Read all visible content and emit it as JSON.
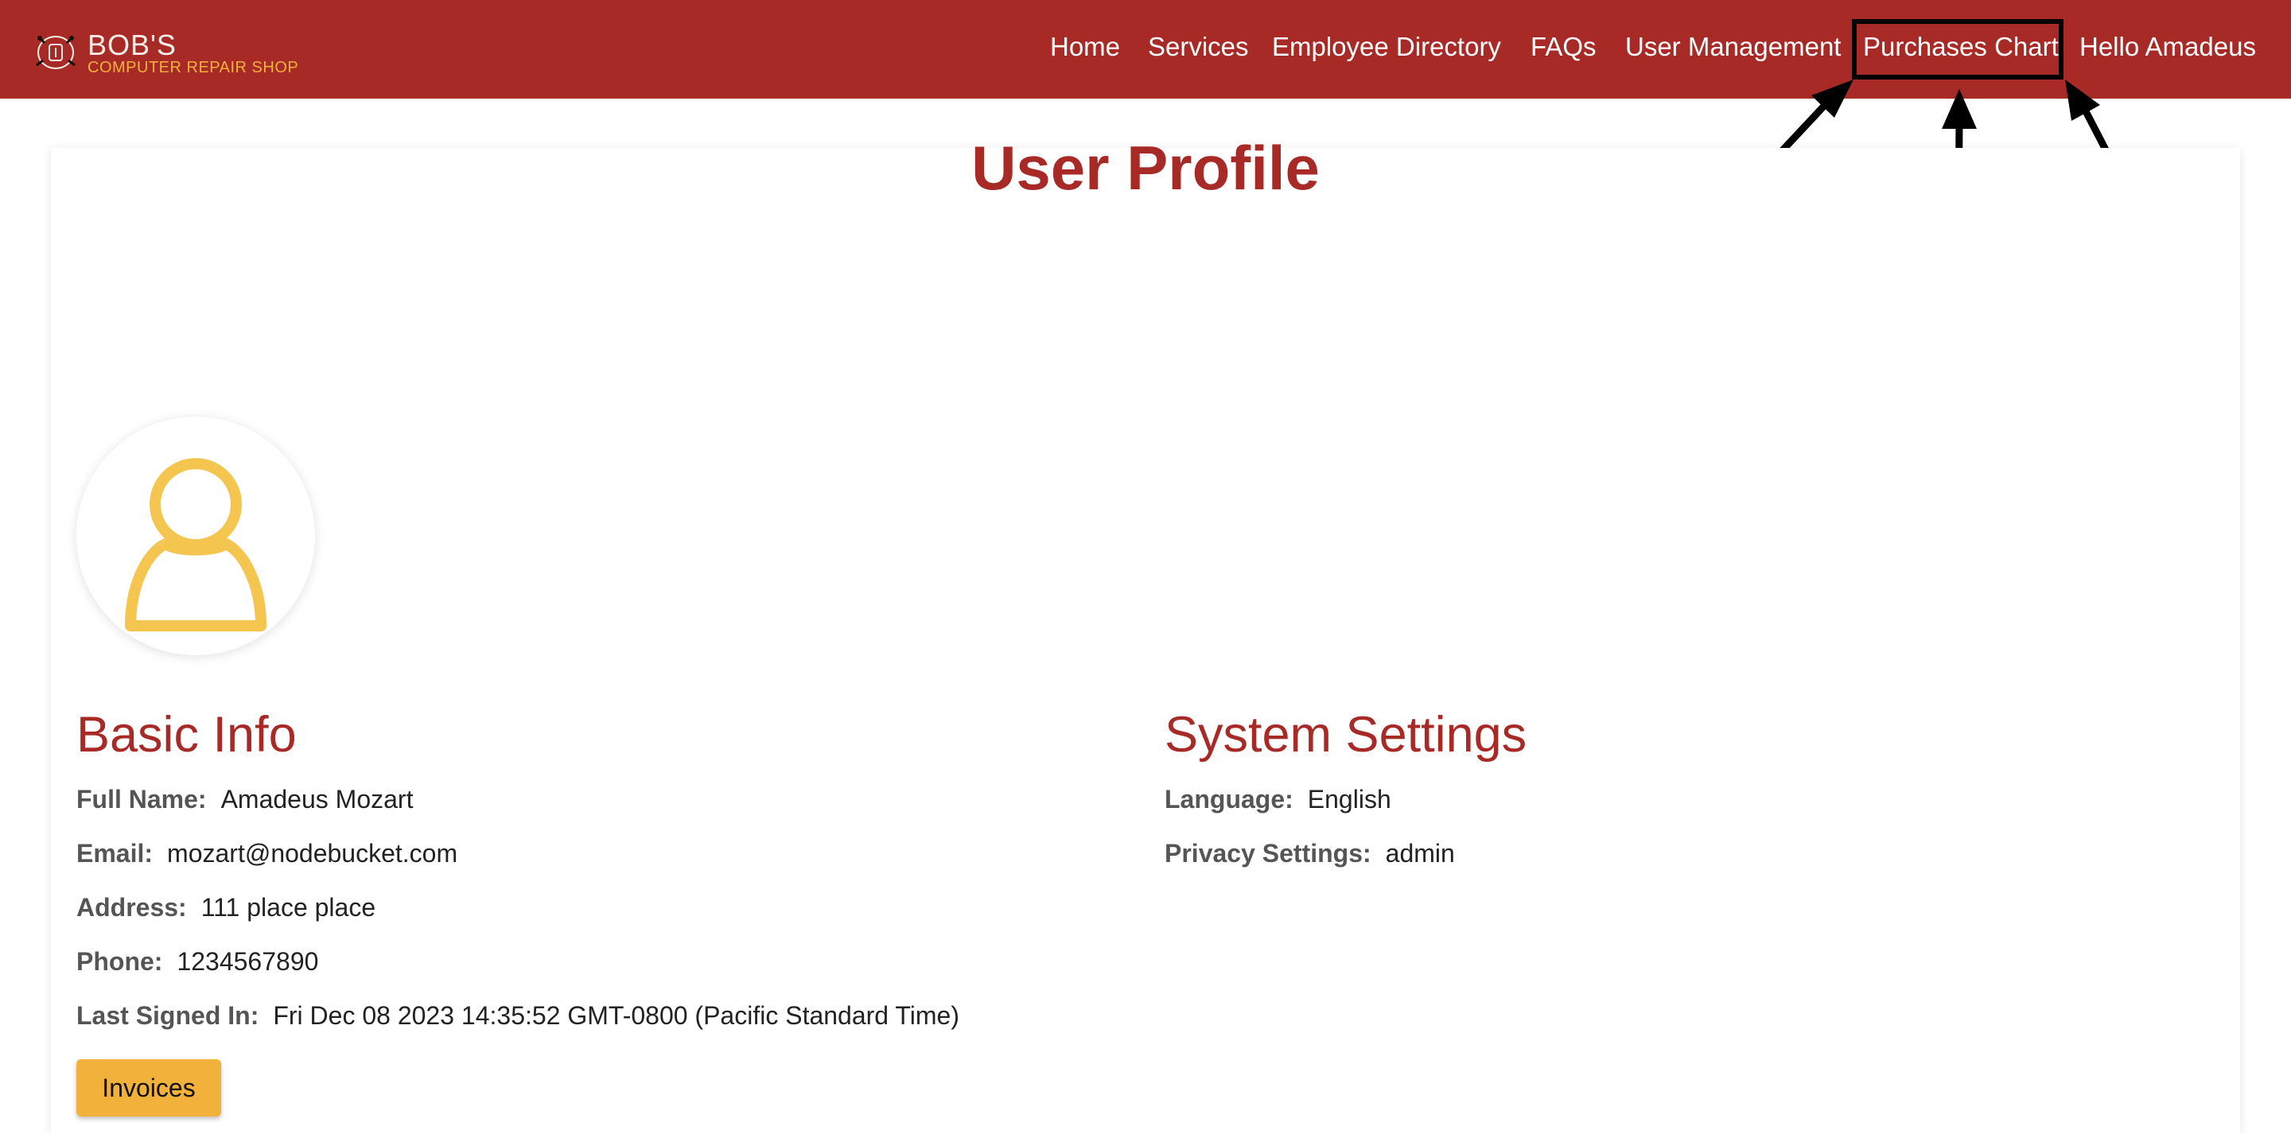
{
  "brand": {
    "name": "BOB'S",
    "subtitle": "COMPUTER REPAIR SHOP"
  },
  "nav": {
    "home": "Home",
    "services": "Services",
    "employee_directory": "Employee Directory",
    "faqs": "FAQs",
    "user_management": "User Management",
    "purchases_chart": "Purchases Chart",
    "greeting": "Hello Amadeus"
  },
  "colors": {
    "brand_red": "#a82a26",
    "accent_yellow": "#f2b13b",
    "avatar_yellow": "#f5c64f"
  },
  "profile": {
    "title": "User Profile",
    "avatar_icon": "user-silhouette-icon"
  },
  "basic_info": {
    "title": "Basic Info",
    "full_name_label": "Full Name:",
    "full_name": "Amadeus Mozart",
    "email_label": "Email:",
    "email": "mozart@nodebucket.com",
    "address_label": "Address:",
    "address": "111 place place",
    "phone_label": "Phone:",
    "phone": "1234567890",
    "last_signed_in_label": "Last Signed In:",
    "last_signed_in": "Fri Dec 08 2023 14:35:52 GMT-0800 (Pacific Standard Time)"
  },
  "system_settings": {
    "title": "System Settings",
    "language_label": "Language:",
    "language": "English",
    "privacy_label": "Privacy Settings:",
    "privacy": "admin"
  },
  "actions": {
    "invoices": "Invoices"
  }
}
